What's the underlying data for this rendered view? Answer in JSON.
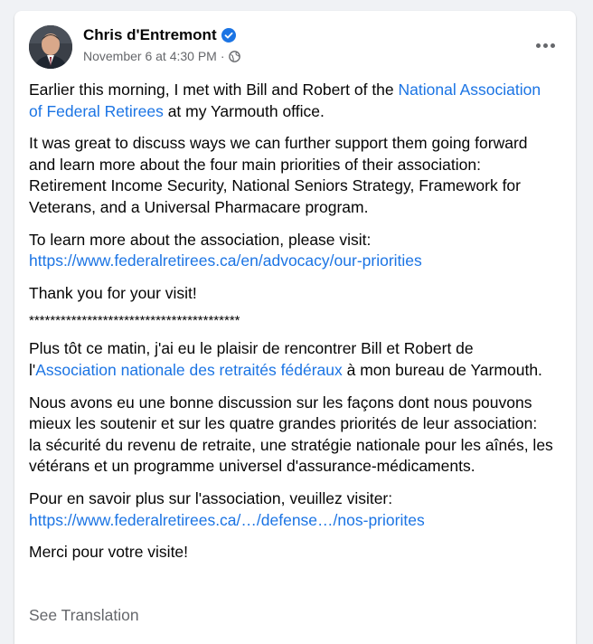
{
  "post": {
    "author": "Chris d'Entremont",
    "timestamp": "November 6 at 4:30 PM",
    "separator": "·",
    "paragraphs": {
      "p1_before": "Earlier this morning, I met with Bill and Robert of the ",
      "p1_link": "National Association of Federal Retirees",
      "p1_after": " at my Yarmouth office.",
      "p2": "It was great to discuss ways we can further support them going forward and learn more about the four main priorities of their association: Retirement Income Security, National Seniors Strategy, Framework for Veterans, and a Universal Pharmacare program.",
      "p3_text": "To learn more about the association, please visit:",
      "p3_link": "https://www.federalretirees.ca/en/advocacy/our-priorities",
      "p4": "Thank you for your visit!",
      "divider": "****************************************",
      "p5_before": "Plus tôt ce matin, j'ai eu le plaisir de rencontrer Bill et Robert de l'",
      "p5_link": "Association nationale des retraités fédéraux",
      "p5_after": " à mon bureau de Yarmouth.",
      "p6": "Nous avons eu une bonne discussion sur les façons dont nous pouvons mieux les soutenir et sur les quatre grandes priorités de leur association: la sécurité du revenu de retraite, une stratégie nationale pour les aînés, les vétérans et un programme universel d'assurance-médicaments.",
      "p7_text": "Pour en savoir plus sur l'association, veuillez visiter:",
      "p7_link": "https://www.federalretirees.ca/…/defense…/nos-priorites",
      "p8": "Merci pour votre visite!"
    },
    "see_translation": "See Translation"
  },
  "colors": {
    "link": "#1b74e4",
    "secondary_text": "#65676b",
    "verified_badge": "#1b74e4",
    "background": "#f0f2f5"
  },
  "icons": {
    "verified": "verified-badge-icon",
    "audience": "globe-icon",
    "more": "more-options-icon"
  }
}
